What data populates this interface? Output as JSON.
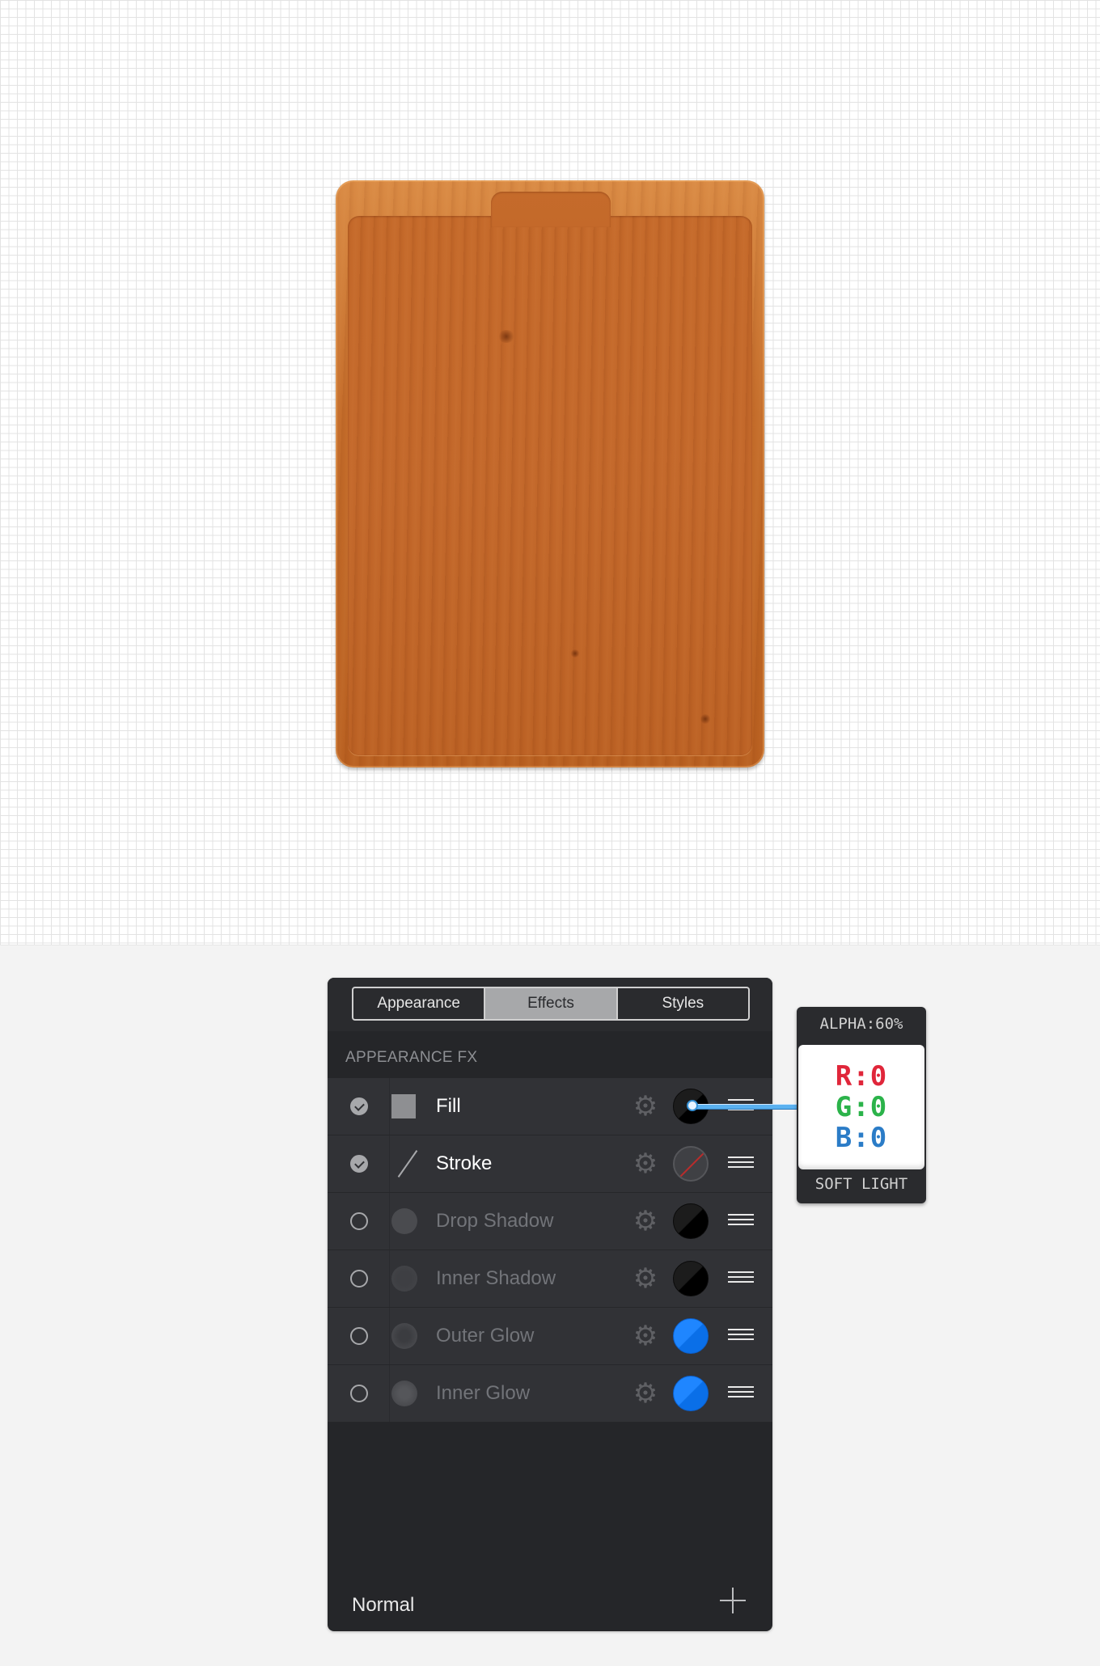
{
  "colors": {
    "red": "#e0263a",
    "green": "#2bb34a",
    "blue": "#2b7cc7",
    "swatch_black": "#000000",
    "swatch_blue": "#1f86ff"
  },
  "tabs": [
    {
      "label": "Appearance",
      "active": false
    },
    {
      "label": "Effects",
      "active": true
    },
    {
      "label": "Styles",
      "active": false
    }
  ],
  "section_title": "APPEARANCE FX",
  "effects": [
    {
      "label": "Fill",
      "enabled": true,
      "icon": "square-icon",
      "swatch": "black"
    },
    {
      "label": "Stroke",
      "enabled": true,
      "icon": "stroke-line-icon",
      "swatch": "none"
    },
    {
      "label": "Drop Shadow",
      "enabled": false,
      "icon": "drop-shadow-icon",
      "swatch": "black"
    },
    {
      "label": "Inner Shadow",
      "enabled": false,
      "icon": "inner-shadow-icon",
      "swatch": "black"
    },
    {
      "label": "Outer Glow",
      "enabled": false,
      "icon": "outer-glow-icon",
      "swatch": "blue"
    },
    {
      "label": "Inner Glow",
      "enabled": false,
      "icon": "inner-glow-icon",
      "swatch": "blue"
    }
  ],
  "footer": {
    "blend_mode": "Normal"
  },
  "tooltip": {
    "alpha": "ALPHA:60%",
    "r": "R:0",
    "g": "G:0",
    "b": "B:0",
    "blend": "SOFT LIGHT"
  }
}
